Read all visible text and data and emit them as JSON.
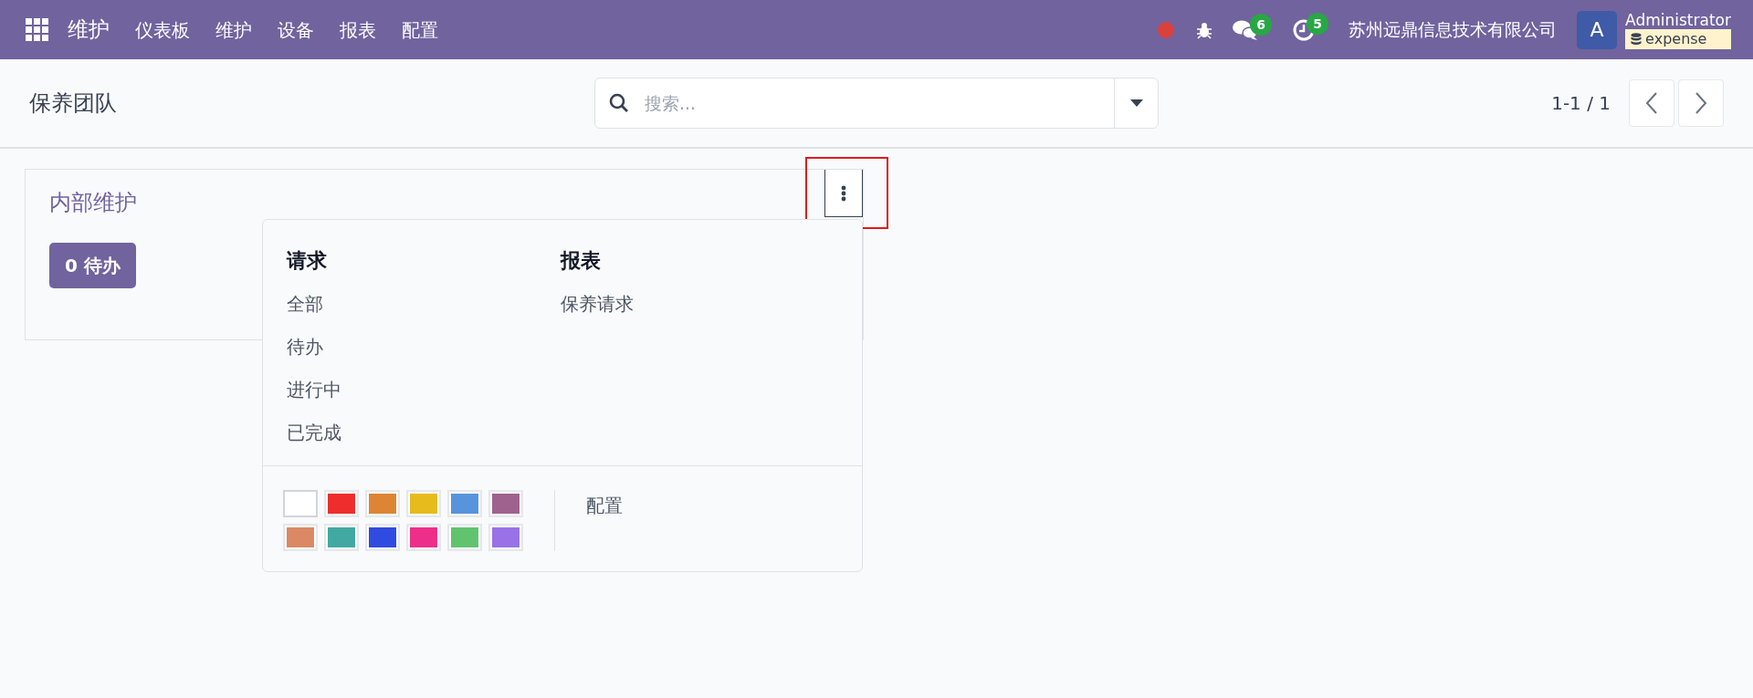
{
  "navbar": {
    "app_name": "维护",
    "menu": [
      "仪表板",
      "维护",
      "设备",
      "报表",
      "配置"
    ],
    "chat_count": "6",
    "activity_count": "5",
    "company": "苏州远鼎信息技术有限公司",
    "avatar_letter": "A",
    "user": "Administrator",
    "database": "expense"
  },
  "control_panel": {
    "title": "保养团队",
    "search": {
      "placeholder": "搜索..."
    },
    "pager": "1-1 / 1"
  },
  "team_card": {
    "name": "内部维护",
    "todo_button": "0 待办",
    "menu_button_highlighted": true,
    "dropdown": {
      "sections": [
        {
          "title": "请求",
          "items": [
            "全部",
            "待办",
            "进行中",
            "已完成"
          ]
        },
        {
          "title": "报表",
          "items": [
            "保养请求"
          ]
        }
      ],
      "colors": [
        {
          "color": "#ffffff",
          "selected": true
        },
        {
          "color": "#ee2d2d",
          "selected": false
        },
        {
          "color": "#dc8534",
          "selected": false
        },
        {
          "color": "#e8bb1d",
          "selected": false
        },
        {
          "color": "#5794dd",
          "selected": false
        },
        {
          "color": "#9f628f",
          "selected": false
        },
        {
          "color": "#db8865",
          "selected": false
        },
        {
          "color": "#41a9a2",
          "selected": false
        },
        {
          "color": "#304be0",
          "selected": false
        },
        {
          "color": "#ee2f8a",
          "selected": false
        },
        {
          "color": "#61c36e",
          "selected": false
        },
        {
          "color": "#9872e6",
          "selected": false
        }
      ],
      "settings_link": "配置"
    }
  }
}
